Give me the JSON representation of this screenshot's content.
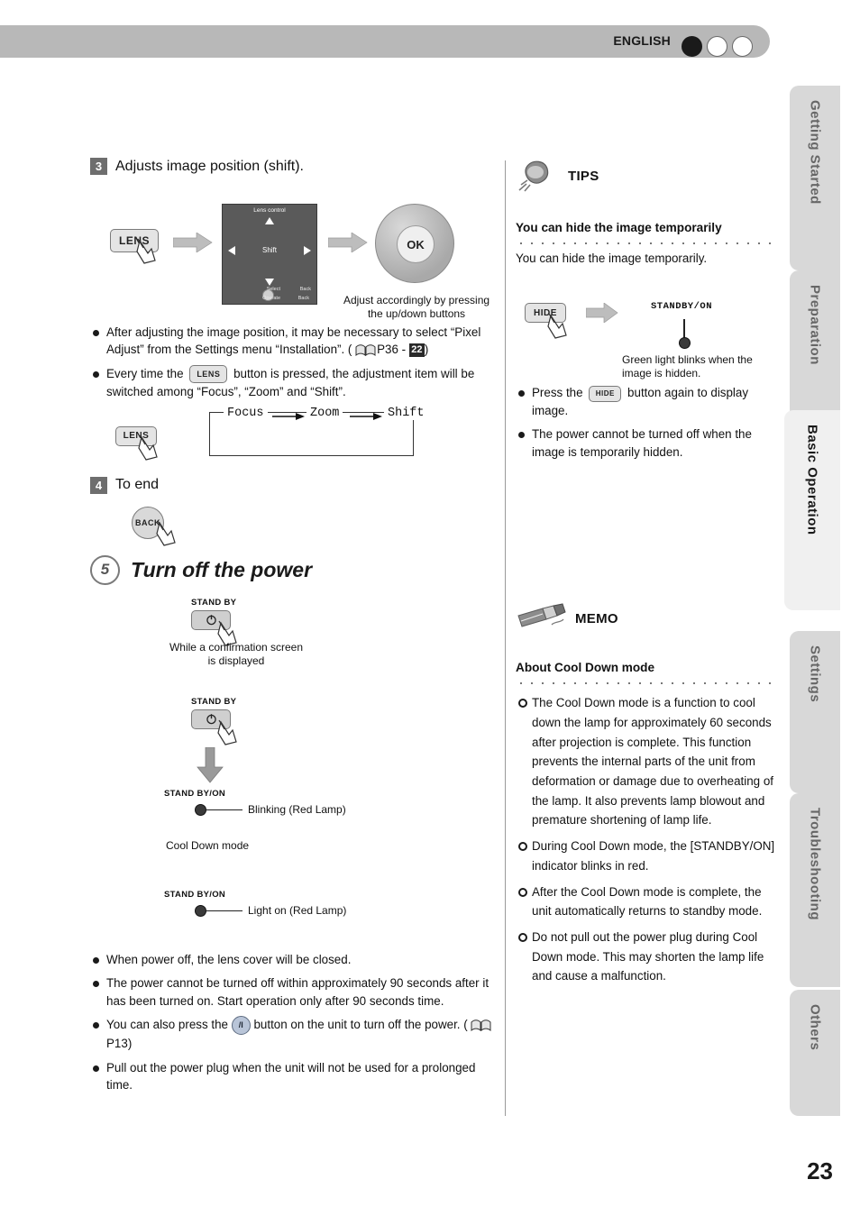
{
  "header": {
    "language": "ENGLISH",
    "dots": [
      "filled",
      "empty",
      "empty"
    ]
  },
  "side_tabs": [
    {
      "label": "Getting Started",
      "active": false
    },
    {
      "label": "Preparation",
      "active": false
    },
    {
      "label": "Basic Operation",
      "active": true
    },
    {
      "label": "Settings",
      "active": false
    },
    {
      "label": "Troubleshooting",
      "active": false
    },
    {
      "label": "Others",
      "active": false
    }
  ],
  "page_number": "23",
  "left": {
    "step3": {
      "number": "3",
      "title": "Adjusts image position (shift).",
      "lens_key": "LENS",
      "osd": {
        "title": "Lens control",
        "label": "Shift",
        "foot_select": "Select",
        "foot_back": "Back",
        "foot_operate": "Operate",
        "foot_backsm": "Back"
      },
      "ok_label": "OK",
      "dpad_caption": "Adjust accordingly by pressing the up/down buttons",
      "bullets": [
        "After adjusting the image position, it may be necessary to select “Pixel Adjust” from the Settings menu “Installation”. (    P36 -  22  )",
        "Every time the   LENS   button is pressed, the adjustment item will be switched among “Focus”, “Zoom” and “Shift”."
      ],
      "bullet1_pre": "After adjusting the image position, it may be necessary to select “Pixel Adjust” from the Settings menu “Installation”. (",
      "bullet1_page": "P36 - ",
      "bullet1_badge": "22",
      "bullet1_post": ")",
      "bullet2_pre": "Every time the",
      "bullet2_key": "LENS",
      "bullet2_post": "button is pressed, the adjustment item will be switched among “Focus”, “Zoom” and “Shift”.",
      "flow": {
        "lens_key": "LENS",
        "focus": "Focus",
        "zoom": "Zoom",
        "shift": "Shift"
      }
    },
    "step4": {
      "number": "4",
      "title": "To end",
      "back_key": "BACK"
    },
    "step5": {
      "number": "5",
      "title": "Turn off the power",
      "standby_label_1": "STAND BY",
      "standby_label_2": "STAND BY",
      "confirm_caption": "While a confirmation screen is displayed",
      "indicator_1": "STAND BY/ON",
      "indicator_1_text": "Blinking (Red Lamp)",
      "cooldown_caption": "Cool Down mode",
      "indicator_2": "STAND BY/ON",
      "indicator_2_text": "Light on (Red Lamp)",
      "bullets": [
        "When power off, the lens cover will be closed.",
        "The power cannot be turned off within approximately 90 seconds after it has been turned on. Start operation only after 90 seconds time.",
        "You can also press the      button on the unit to turn off the power. (    P13)",
        "Pull out the power plug when the unit will not be used for a prolonged time."
      ],
      "bullet3_pre": "You can also press the",
      "bullet3_btn": "/I",
      "bullet3_mid": "button on the unit to turn off the power. (",
      "bullet3_page": "P13)"
    }
  },
  "right": {
    "tips": {
      "label": "TIPS",
      "heading": "You can hide the image temporarily",
      "intro": "You can hide the image temporarily.",
      "hide_key": "HIDE",
      "standby_label": "STANDBY/ON",
      "lamp_caption": "Green light blinks when the image is hidden.",
      "bullet1_pre": "Press the",
      "bullet1_key": "HIDE",
      "bullet1_post": "button again to display image.",
      "bullet2": "The power cannot be turned off when the image is temporarily hidden."
    },
    "memo": {
      "label": "MEMO",
      "heading": "About Cool Down mode",
      "bullets": [
        "The Cool Down mode is a function to cool down the lamp for approximately 60 seconds after projection is complete. This function prevents the internal parts of the unit from deformation or damage due to overheating of the lamp. It also prevents lamp blowout and premature shortening of lamp life.",
        "During Cool Down mode, the [STANDBY/ON] indicator blinks in red.",
        "After the Cool Down mode is complete, the unit automatically returns to standby mode.",
        "Do not pull out the power plug during Cool Down mode. This may shorten the lamp life and cause a malfunction."
      ]
    }
  }
}
